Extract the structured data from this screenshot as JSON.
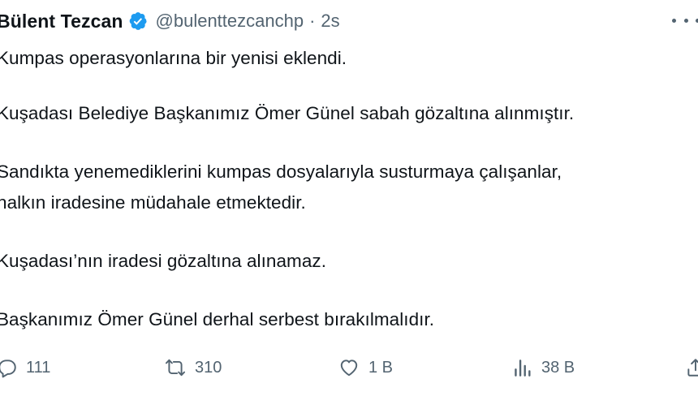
{
  "tweet": {
    "author": {
      "display_name": "Bülent Tezcan",
      "handle": "@bulenttezcanchp",
      "separator": "·",
      "time": "2s",
      "verified_color": "#1d9bf0"
    },
    "paragraphs": [
      "Kumpas operasyonlarına bir yenisi eklendi.",
      "Kuşadası Belediye Başkanımız Ömer Günel sabah gözaltına alınmıştır.",
      "Sandıkta yenemediklerini kumpas dosyalarıyla susturmaya çalışanlar,",
      "halkın iradesine müdahale etmektedir.",
      "Kuşadası’nın iradesi gözaltına alınamaz.",
      "Başkanımız Ömer Günel derhal serbest bırakılmalıdır."
    ],
    "actions": {
      "reply": {
        "icon": "reply-icon",
        "count": "111"
      },
      "retweet": {
        "icon": "retweet-icon",
        "count": "310"
      },
      "like": {
        "icon": "heart-icon",
        "count": "1 B"
      },
      "views": {
        "icon": "views-icon",
        "count": "38 B"
      },
      "share": {
        "icon": "share-icon"
      }
    },
    "colors": {
      "text": "#0f1419",
      "secondary": "#536471"
    }
  }
}
